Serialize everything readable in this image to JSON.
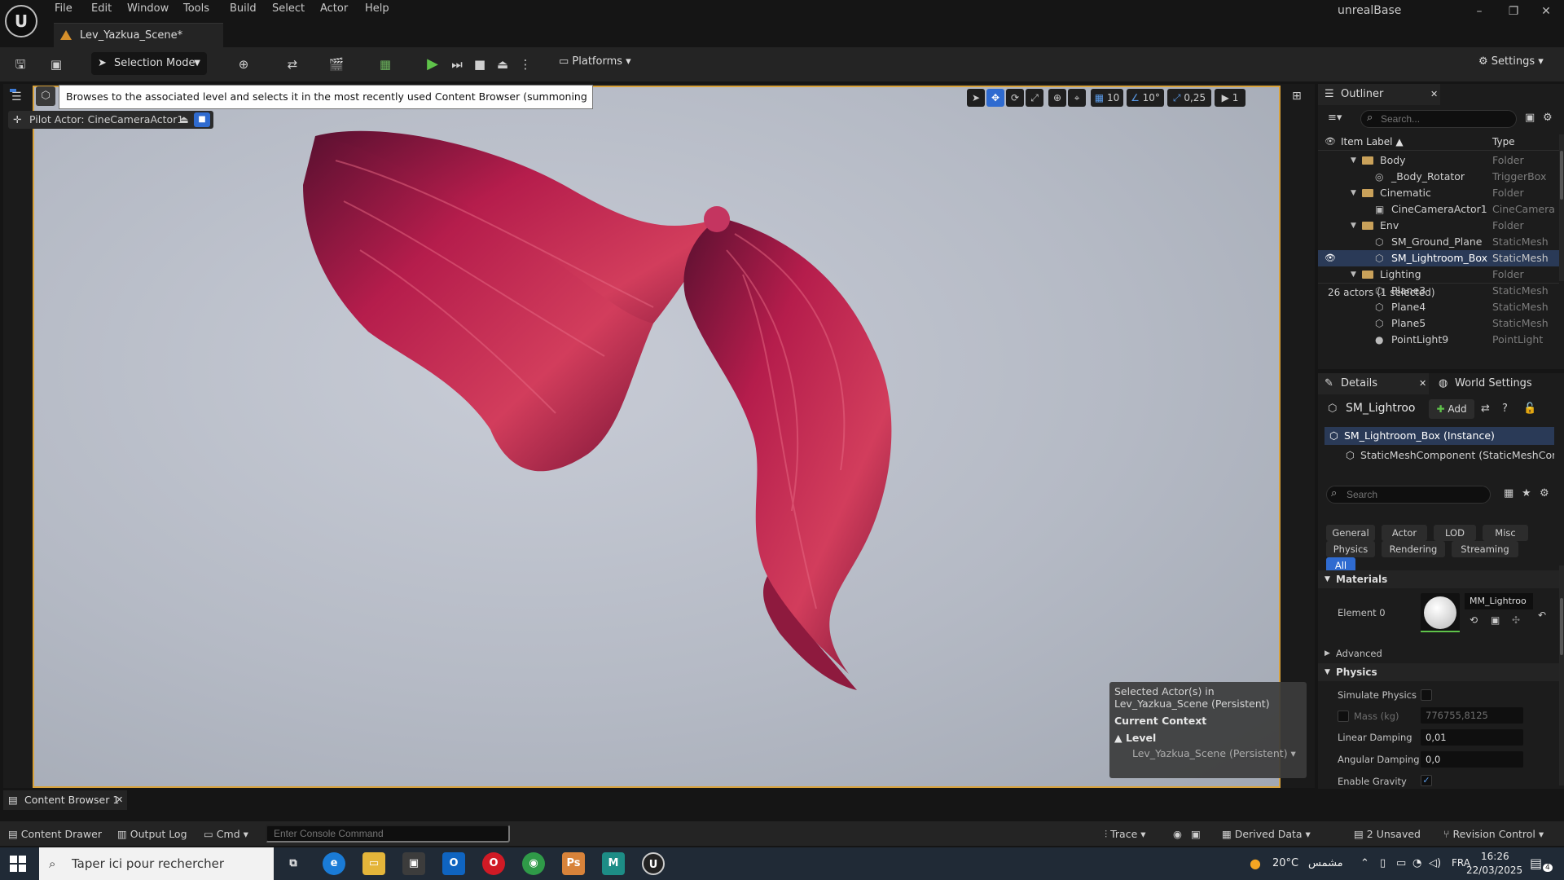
{
  "app": {
    "name": "unrealBase",
    "logo": "U",
    "menu": [
      "File",
      "Edit",
      "Window",
      "Tools",
      "Build",
      "Select",
      "Actor",
      "Help"
    ],
    "window_controls": [
      "–",
      "❐",
      "✕"
    ]
  },
  "document_tab": {
    "label": "Lev_Yazkua_Scene*"
  },
  "toolbar": {
    "selection_mode": "Selection Mode",
    "platforms": "Platforms",
    "settings": "Settings"
  },
  "viewport": {
    "tooltip": "Browses to the associated level and selects it in the most recently used Content Browser (summoning one if necessary)",
    "pilot_label": "Pilot Actor: CineCameraActor1",
    "grid_snap": "10",
    "angle_snap": "10°",
    "scale_snap": "0,25",
    "camera_speed": "1",
    "context": {
      "selected_line1": "Selected Actor(s) in",
      "selected_line2": "Lev_Yazkua_Scene (Persistent)",
      "header": "Current Context",
      "level_label": "Level",
      "level_value": "Lev_Yazkua_Scene (Persistent)"
    },
    "hair_color": "#b01a48",
    "frame_color": "#d8a23b"
  },
  "outliner": {
    "title": "Outliner",
    "search_placeholder": "Search...",
    "col_label": "Item Label ▲",
    "col_type": "Type",
    "rows": [
      {
        "label": "Body",
        "type": "Folder",
        "indent": 1,
        "kind": "folder"
      },
      {
        "label": "_Body_Rotator",
        "type": "TriggerBox",
        "indent": 2,
        "kind": "actor"
      },
      {
        "label": "Cinematic",
        "type": "Folder",
        "indent": 1,
        "kind": "folder"
      },
      {
        "label": "CineCameraActor1",
        "type": "CineCamera",
        "indent": 2,
        "kind": "camera"
      },
      {
        "label": "Env",
        "type": "Folder",
        "indent": 1,
        "kind": "folder"
      },
      {
        "label": "SM_Ground_Plane",
        "type": "StaticMesh",
        "indent": 2,
        "kind": "mesh"
      },
      {
        "label": "SM_Lightroom_Box",
        "type": "StaticMesh",
        "indent": 2,
        "kind": "mesh",
        "selected": true
      },
      {
        "label": "Lighting",
        "type": "Folder",
        "indent": 1,
        "kind": "folder"
      },
      {
        "label": "Plane3",
        "type": "StaticMesh",
        "indent": 2,
        "kind": "mesh"
      },
      {
        "label": "Plane4",
        "type": "StaticMesh",
        "indent": 2,
        "kind": "mesh"
      },
      {
        "label": "Plane5",
        "type": "StaticMesh",
        "indent": 2,
        "kind": "mesh"
      },
      {
        "label": "PointLight9",
        "type": "PointLight",
        "indent": 2,
        "kind": "light"
      }
    ],
    "footer": "26 actors (1 selected)"
  },
  "details": {
    "tab_label": "Details",
    "world_settings_label": "World Settings",
    "actor_name": "SM_Lightroo",
    "add_label": "Add",
    "components": [
      "SM_Lightroom_Box (Instance)",
      "StaticMeshComponent (StaticMeshComp"
    ],
    "search_placeholder": "Search",
    "filters": [
      "General",
      "Actor",
      "LOD",
      "Misc",
      "Physics",
      "Rendering",
      "Streaming",
      "All"
    ],
    "materials_header": "Materials",
    "element_label": "Element 0",
    "material_name": "MM_Lightroo",
    "advanced_label": "Advanced",
    "physics_header": "Physics",
    "simulate_physics_label": "Simulate Physics",
    "mass_label": "Mass (kg)",
    "mass_value": "776755,8125",
    "linear_damping_label": "Linear Damping",
    "linear_damping_value": "0,01",
    "angular_damping_label": "Angular Damping",
    "angular_damping_value": "0,0",
    "enable_gravity_label": "Enable Gravity"
  },
  "content_browser": {
    "tab_label": "Content Browser 1"
  },
  "statusbar": {
    "content_drawer": "Content Drawer",
    "output_log": "Output Log",
    "cmd": "Cmd",
    "console_placeholder": "Enter Console Command",
    "trace": "Trace",
    "derived_data": "Derived Data",
    "unsaved": "2 Unsaved",
    "revision_control": "Revision Control"
  },
  "taskbar": {
    "search_placeholder": "Taper ici pour rechercher",
    "temperature": "20°C",
    "weather_text": "مشمس",
    "language": "FRA",
    "time": "16:26",
    "date": "22/03/2025",
    "notification_count": "4"
  }
}
